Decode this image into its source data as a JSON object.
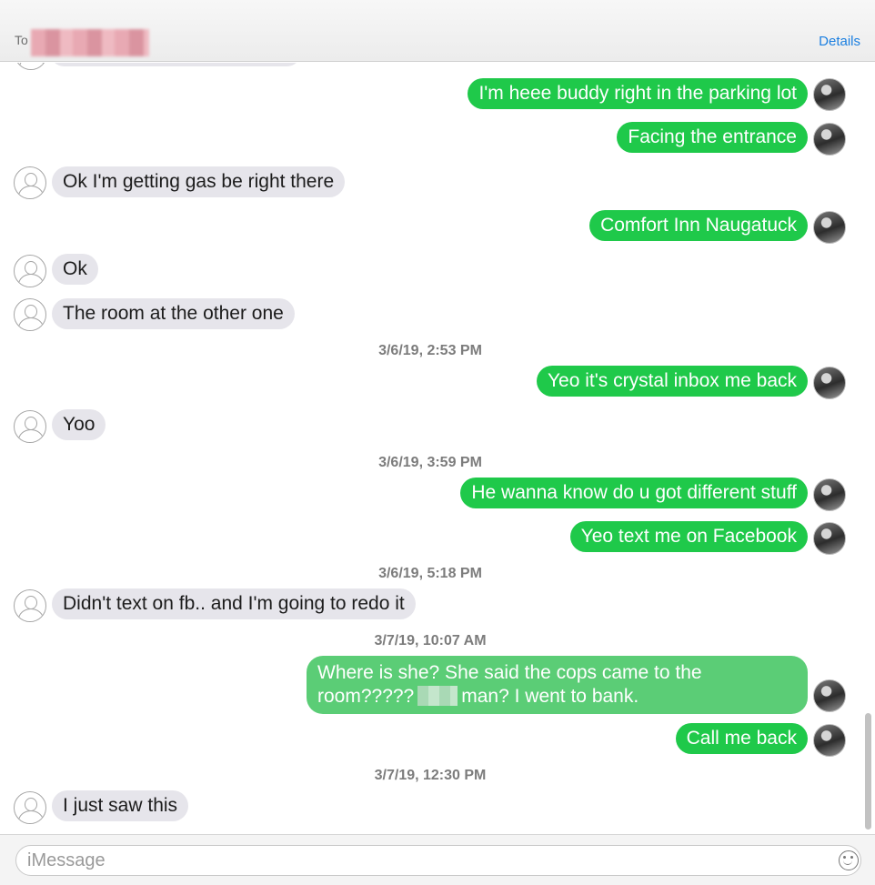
{
  "header": {
    "to_label": "To",
    "details_label": "Details"
  },
  "messages": {
    "m1": "I'm heee buddy right in the parking lot",
    "m2": "Facing the entrance",
    "m3": "Ok I'm getting gas be right there",
    "m4": "Comfort Inn Naugatuck",
    "m5": "Ok",
    "m6": "The room at the other one",
    "ts1": "3/6/19, 2:53 PM",
    "m7": "Yeo it's crystal inbox me back",
    "m8": "Yoo",
    "ts2": "3/6/19, 3:59 PM",
    "m9": "He wanna know do u got different stuff",
    "m10": "Yeo text me on Facebook",
    "ts3": "3/6/19, 5:18 PM",
    "m11": "Didn't text on fb.. and I'm going to redo it",
    "ts4": "3/7/19, 10:07 AM",
    "m12_part1": "Where is she? She said the cops came to the room?????",
    "m12_part2": "man? I went to bank.",
    "m13": "Call me back",
    "ts5": "3/7/19, 12:30 PM",
    "m14": "I just saw this"
  },
  "compose": {
    "placeholder": "iMessage"
  },
  "colors": {
    "outgoing": "#1fc94a",
    "incoming": "#e6e5eb",
    "link": "#1b7fe0"
  },
  "icons": [
    "contact-avatar-icon",
    "sender-avatar-icon",
    "emoji-icon"
  ]
}
